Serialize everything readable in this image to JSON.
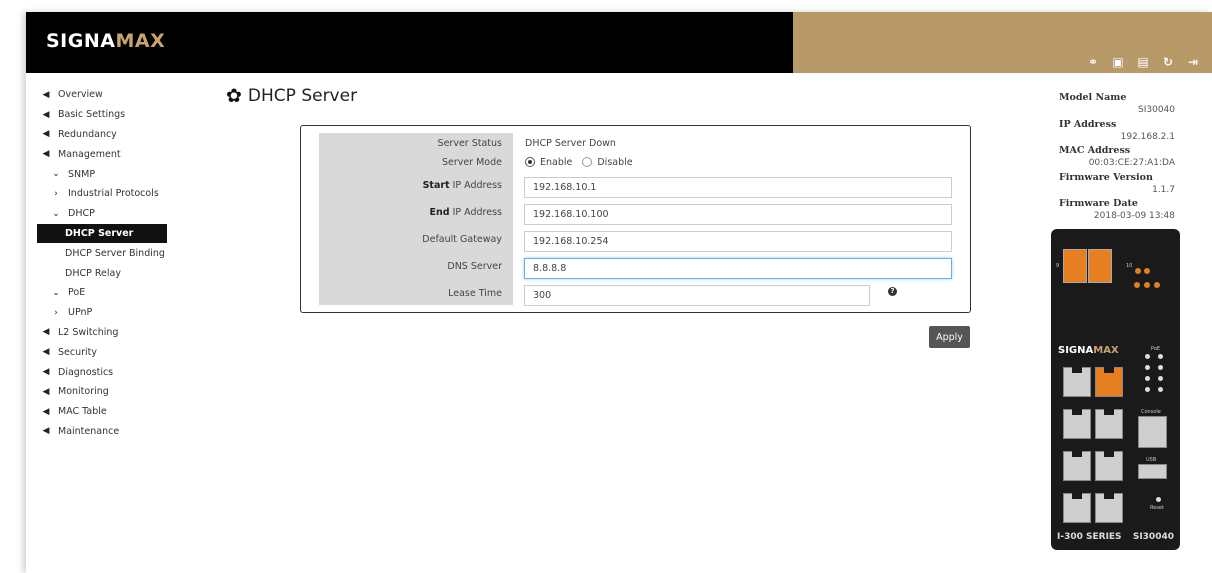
{
  "brand": {
    "part1": "SIGNA",
    "part2": "MAX"
  },
  "header_icons": [
    {
      "name": "link-icon",
      "glyph": "⚭"
    },
    {
      "name": "save-icon",
      "glyph": "▣"
    },
    {
      "name": "save-config-icon",
      "glyph": "▤"
    },
    {
      "name": "refresh-icon",
      "glyph": "↻"
    },
    {
      "name": "logout-icon",
      "glyph": "⇥"
    }
  ],
  "sidebar": {
    "items": [
      {
        "label": "Overview",
        "icon": "send-icon",
        "glyph": "◀",
        "level": 0
      },
      {
        "label": "Basic Settings",
        "icon": "send-icon",
        "glyph": "◀",
        "level": 0
      },
      {
        "label": "Redundancy",
        "icon": "send-icon",
        "glyph": "◀",
        "level": 0
      },
      {
        "label": "Management",
        "icon": "send-icon",
        "glyph": "◀",
        "level": 0
      },
      {
        "label": "SNMP",
        "icon": "chevron-down-icon",
        "glyph": "⌄",
        "level": 1
      },
      {
        "label": "Industrial Protocols",
        "icon": "chevron-right-icon",
        "glyph": "›",
        "level": 1
      },
      {
        "label": "DHCP",
        "icon": "chevron-down-icon",
        "glyph": "⌄",
        "level": 1
      },
      {
        "label": "DHCP Server",
        "icon": "",
        "glyph": "",
        "level": 2,
        "active": true
      },
      {
        "label": "DHCP Server Binding",
        "icon": "",
        "glyph": "",
        "level": 2
      },
      {
        "label": "DHCP Relay",
        "icon": "",
        "glyph": "",
        "level": 2
      },
      {
        "label": "PoE",
        "icon": "chevron-down-icon",
        "glyph": "⌄",
        "level": 1
      },
      {
        "label": "UPnP",
        "icon": "chevron-right-icon",
        "glyph": "›",
        "level": 1
      },
      {
        "label": "L2 Switching",
        "icon": "send-icon",
        "glyph": "◀",
        "level": 0
      },
      {
        "label": "Security",
        "icon": "send-icon",
        "glyph": "◀",
        "level": 0
      },
      {
        "label": "Diagnostics",
        "icon": "send-icon",
        "glyph": "◀",
        "level": 0
      },
      {
        "label": "Monitoring",
        "icon": "send-icon",
        "glyph": "◀",
        "level": 0
      },
      {
        "label": "MAC Table",
        "icon": "send-icon",
        "glyph": "◀",
        "level": 0
      },
      {
        "label": "Maintenance",
        "icon": "send-icon",
        "glyph": "◀",
        "level": 0
      }
    ]
  },
  "page": {
    "title": "DHCP Server"
  },
  "form": {
    "server_status_label": "Server Status",
    "server_status_value": "DHCP Server Down",
    "server_mode_label": "Server Mode",
    "mode_enable": "Enable",
    "mode_disable": "Disable",
    "mode_selected": "Enable",
    "start_ip_label_bold": "Start",
    "start_ip_label_rest": " IP Address",
    "start_ip_value": "192.168.10.1",
    "end_ip_label_bold": "End",
    "end_ip_label_rest": " IP Address",
    "end_ip_value": "192.168.10.100",
    "gateway_label": "Default Gateway",
    "gateway_value": "192.168.10.254",
    "dns_label": "DNS Server",
    "dns_value": "8.8.8.8",
    "lease_label": "Lease Time",
    "lease_value": "300",
    "apply_label": "Apply"
  },
  "info": {
    "model_name_label": "Model Name",
    "model_name": "SI30040",
    "ip_label": "IP Address",
    "ip": "192.168.2.1",
    "mac_label": "MAC Address",
    "mac": "00:03:CE:27:A1:DA",
    "fw_ver_label": "Firmware Version",
    "fw_ver": "1.1.7",
    "fw_date_label": "Firmware Date",
    "fw_date": "2018-03-09 13:48"
  },
  "device": {
    "brand1": "SIGNA",
    "brand2": "MAX",
    "series": "I-300 SERIES",
    "model": "SI30040",
    "poe_label": "PoE",
    "console_label": "Console",
    "usb_label": "USB",
    "reset_label": "Reset",
    "port_9": "9",
    "port_10": "10"
  },
  "colors": {
    "header": "#000000",
    "header_accent": "#b89968",
    "brand_accent": "#c9a46c",
    "active_nav": "#111111",
    "apply_button": "#555555"
  }
}
